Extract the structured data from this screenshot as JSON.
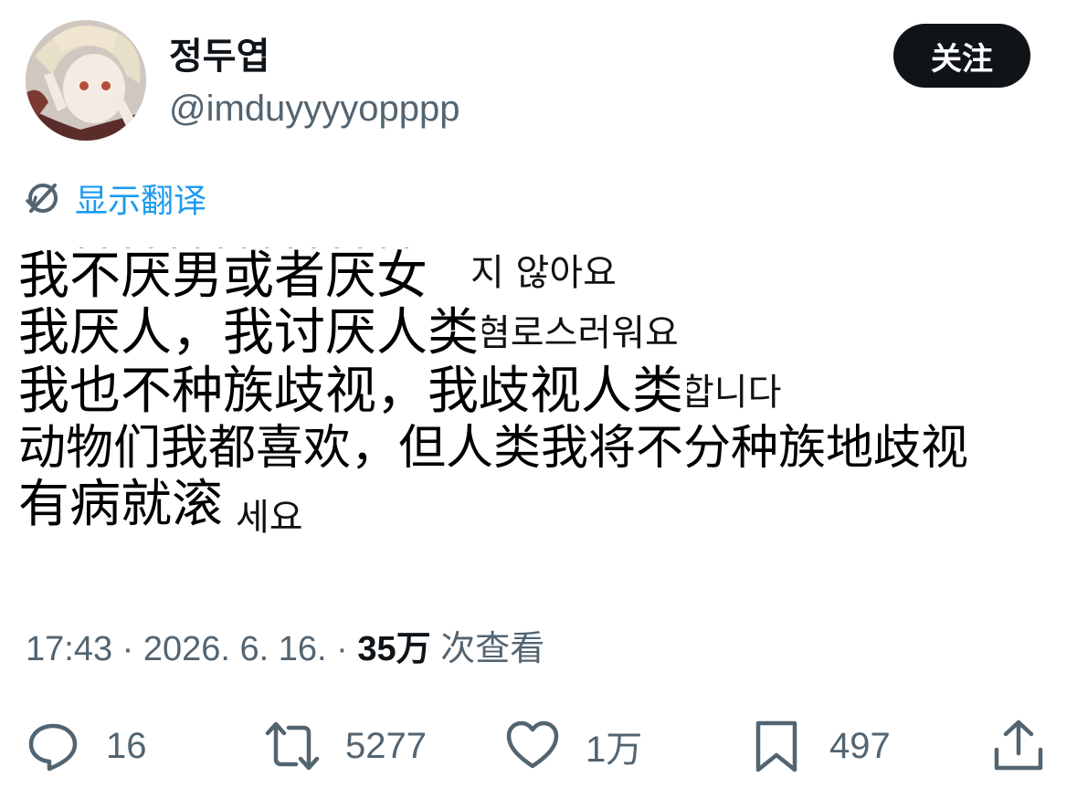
{
  "author": {
    "display_name": "정두엽",
    "handle": "@imduyyyyopppp"
  },
  "follow_label": "关注",
  "translate_label": "显示翻译",
  "image": {
    "background_korean_lines": [
      "지 않아요",
      "혐로스러워요",
      "합니다",
      "세요"
    ],
    "overlay_chinese_lines": [
      "我不厌男或者厌女",
      "我厌人，我讨厌人类",
      "我也不种族歧视，我歧视人类",
      "动物们我都喜欢，但人类我将不分种族地歧视",
      "有病就滚"
    ]
  },
  "meta": {
    "time_date": "17:43 · 2026. 6. 16. · ",
    "views_count": "35万",
    "views_label": " 次查看"
  },
  "actions": {
    "reply_count": "16",
    "retweet_count": "5277",
    "like_count": "1万",
    "bookmark_count": "497"
  },
  "colors": {
    "text_primary": "#0f1419",
    "text_secondary": "#536471",
    "link_blue": "#1d9bf0",
    "button_bg": "#0f1419"
  },
  "icons": {
    "translate": "translate-icon",
    "reply": "reply-icon",
    "retweet": "retweet-icon",
    "like": "heart-icon",
    "bookmark": "bookmark-icon",
    "share": "share-icon"
  }
}
